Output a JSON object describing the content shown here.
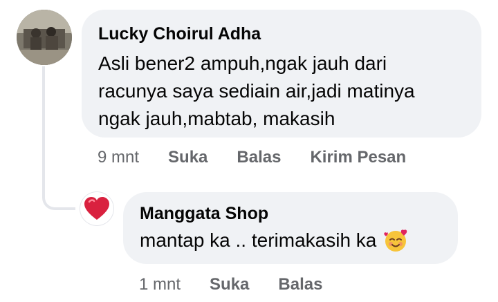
{
  "comment": {
    "author": "Lucky Choirul Adha",
    "text": "Asli bener2 ampuh,ngak jauh dari\nracunya saya sediain air,jadi matinya\nngak jauh,mabtab, makasih",
    "time": "9 mnt",
    "like_label": "Suka",
    "reply_label": "Balas",
    "message_label": "Kirim Pesan",
    "avatar_icon": "user-photo-avatar"
  },
  "reply": {
    "author": "Manggata Shop",
    "text": "mantap ka .. terimakasih ka",
    "emoji_icon": "smiling-face-with-hearts-emoji",
    "time": "1 mnt",
    "like_label": "Suka",
    "reply_label": "Balas",
    "avatar_icon": "red-heart-avatar"
  },
  "colors": {
    "bubble": "#f0f2f5",
    "meta_text": "#65676b",
    "thread_line": "#e4e6eb",
    "heart": "#e0245e"
  }
}
